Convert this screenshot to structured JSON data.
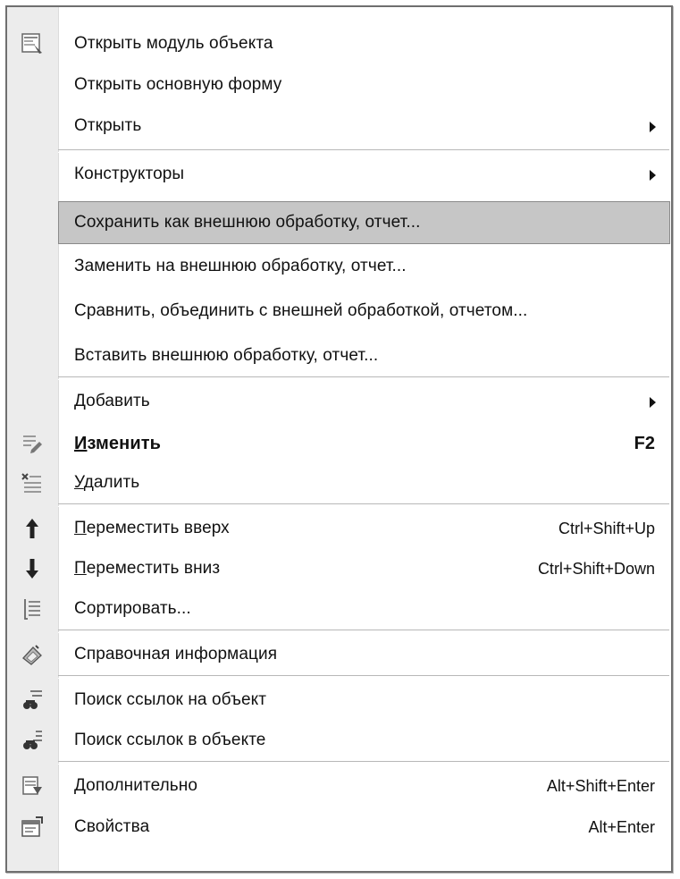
{
  "menu": {
    "items": [
      {
        "label": "Открыть модуль объекта",
        "shortcut": "",
        "icon": "module-form-icon"
      },
      {
        "label": "Открыть основную форму",
        "shortcut": ""
      },
      {
        "label": "Открыть",
        "shortcut": "",
        "submenu": true
      },
      {
        "label": "Конструкторы",
        "shortcut": "",
        "submenu": true
      },
      {
        "label": "Сохранить как внешнюю обработку, отчет...",
        "shortcut": "",
        "highlighted": true
      },
      {
        "label": "Заменить на внешнюю обработку, отчет...",
        "shortcut": ""
      },
      {
        "label": "Сравнить, объединить с внешней обработкой, отчетом...",
        "shortcut": ""
      },
      {
        "label": "Вставить внешнюю обработку, отчет...",
        "shortcut": ""
      },
      {
        "label": "Добавить",
        "shortcut": "",
        "submenu": true
      },
      {
        "label_mnemonic": "И",
        "label_rest": "зменить",
        "shortcut": "F2",
        "icon": "edit-icon",
        "bold": true
      },
      {
        "label_mnemonic": "У",
        "label_rest": "далить",
        "shortcut": "",
        "icon": "delete-icon"
      },
      {
        "label_mnemonic": "П",
        "label_rest": "ереместить вверх",
        "shortcut": "Ctrl+Shift+Up",
        "icon": "arrow-up-icon"
      },
      {
        "label_mnemonic": "П",
        "label_rest": "ереместить вниз",
        "shortcut": "Ctrl+Shift+Down",
        "icon": "arrow-down-icon"
      },
      {
        "label": "Сортировать...",
        "shortcut": "",
        "icon": "sort-icon"
      },
      {
        "label": "Справочная информация",
        "shortcut": "",
        "icon": "help-info-icon"
      },
      {
        "label": "Поиск ссылок на объект",
        "shortcut": "",
        "icon": "find-references-to-icon"
      },
      {
        "label": "Поиск ссылок в объекте",
        "shortcut": "",
        "icon": "find-references-in-icon"
      },
      {
        "label": "Дополнительно",
        "shortcut": "Alt+Shift+Enter",
        "icon": "advanced-icon"
      },
      {
        "label": "Свойства",
        "shortcut": "Alt+Enter",
        "icon": "properties-icon"
      }
    ]
  }
}
